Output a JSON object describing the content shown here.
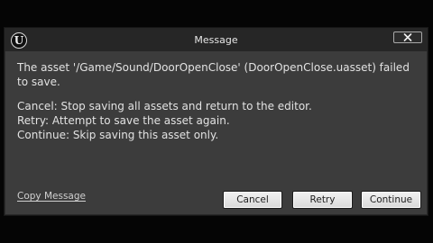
{
  "dialog": {
    "title": "Message",
    "close_icon": "close-icon",
    "logo_icon": "unreal-logo-icon",
    "logo_glyph": "U"
  },
  "message": {
    "line1": "The asset '/Game/Sound/DoorOpenClose' (DoorOpenClose.uasset) failed to save.",
    "line2": "Cancel: Stop saving all assets and return to the editor.",
    "line3": "Retry: Attempt to save the asset again.",
    "line4": "Continue: Skip saving this asset only."
  },
  "footer": {
    "copy_label": "Copy Message",
    "cancel_label": "Cancel",
    "retry_label": "Retry",
    "continue_label": "Continue"
  }
}
